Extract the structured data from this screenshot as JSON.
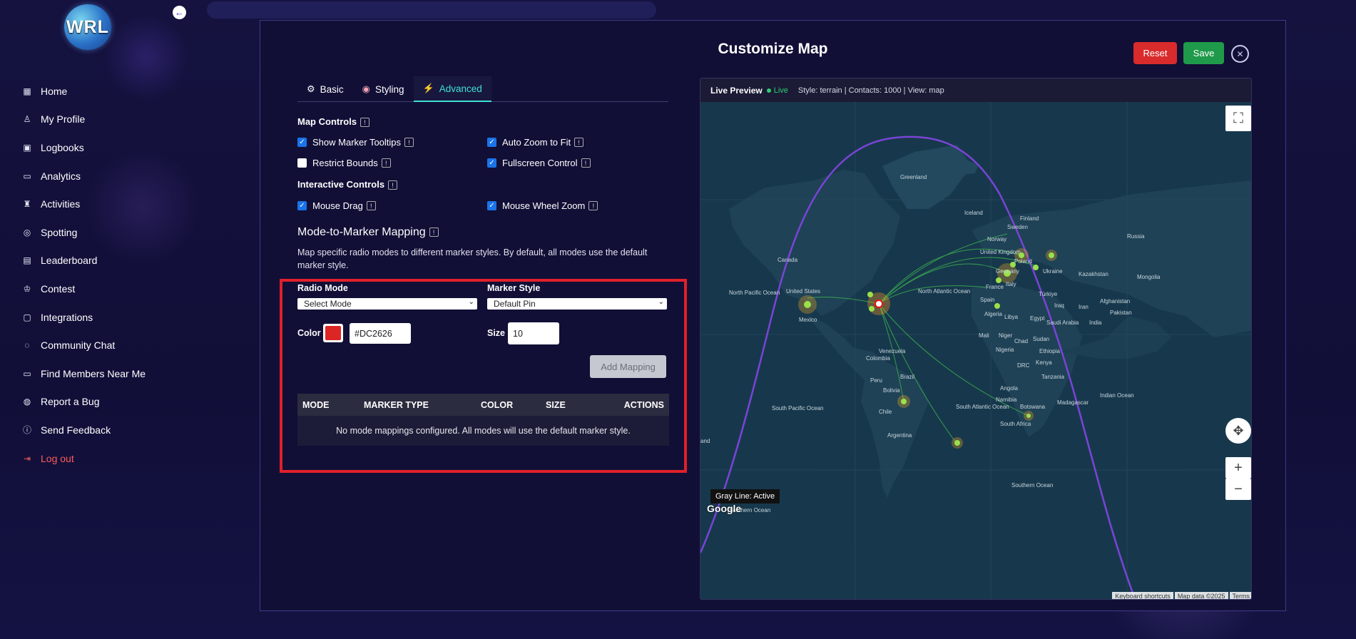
{
  "app": {
    "logo_text": "WRL"
  },
  "sidebar": {
    "items": [
      {
        "label": "Home",
        "icon": "grid-icon"
      },
      {
        "label": "My Profile",
        "icon": "user-icon"
      },
      {
        "label": "Logbooks",
        "icon": "contact-book-icon"
      },
      {
        "label": "Analytics",
        "icon": "chart-icon"
      },
      {
        "label": "Activities",
        "icon": "people-icon"
      },
      {
        "label": "Spotting",
        "icon": "radar-icon"
      },
      {
        "label": "Leaderboard",
        "icon": "podium-icon"
      },
      {
        "label": "Contest",
        "icon": "trophy-icon"
      },
      {
        "label": "Integrations",
        "icon": "plug-icon"
      },
      {
        "label": "Community Chat",
        "icon": "chat-icon"
      },
      {
        "label": "Find Members Near Me",
        "icon": "folder-icon"
      },
      {
        "label": "Report a Bug",
        "icon": "bug-icon"
      },
      {
        "label": "Send Feedback",
        "icon": "alert-circle-icon"
      },
      {
        "label": "Log out",
        "icon": "logout-icon"
      }
    ]
  },
  "modal": {
    "title": "Customize Map",
    "reset_label": "Reset",
    "save_label": "Save",
    "tabs": [
      {
        "label": "Basic",
        "icon": "gear-icon"
      },
      {
        "label": "Styling",
        "icon": "palette-icon"
      },
      {
        "label": "Advanced",
        "icon": "lightning-icon"
      }
    ],
    "active_tab": "Advanced",
    "map_controls": {
      "heading": "Map Controls",
      "items": [
        {
          "label": "Show Marker Tooltips",
          "checked": true
        },
        {
          "label": "Auto Zoom to Fit",
          "checked": true
        },
        {
          "label": "Restrict Bounds",
          "checked": false
        },
        {
          "label": "Fullscreen Control",
          "checked": true
        }
      ]
    },
    "interactive_controls": {
      "heading": "Interactive Controls",
      "items": [
        {
          "label": "Mouse Drag",
          "checked": true
        },
        {
          "label": "Mouse Wheel Zoom",
          "checked": true
        }
      ]
    },
    "mapping": {
      "heading": "Mode-to-Marker Mapping",
      "description": "Map specific radio modes to different marker styles. By default, all modes use the default marker style.",
      "radio_mode_label": "Radio Mode",
      "radio_mode_value": "Select Mode",
      "marker_style_label": "Marker Style",
      "marker_style_value": "Default Pin",
      "color_label": "Color",
      "color_value": "#DC2626",
      "size_label": "Size",
      "size_value": "10",
      "add_button": "Add Mapping",
      "columns": [
        "MODE",
        "MARKER TYPE",
        "COLOR",
        "SIZE",
        "ACTIONS"
      ],
      "empty_text": "No mode mappings configured. All modes will use the default marker style."
    }
  },
  "preview": {
    "title": "Live Preview",
    "status": "Live",
    "info": "Style: terrain | Contacts: 1000 | View: map",
    "gray_line": "Gray Line: Active",
    "google": "Google",
    "attribution": [
      "Keyboard shortcuts",
      "Map data ©2025",
      "Terms"
    ],
    "labels": [
      {
        "text": "Greenland"
      },
      {
        "text": "Iceland"
      },
      {
        "text": "Finland"
      },
      {
        "text": "Sweden"
      },
      {
        "text": "Norway"
      },
      {
        "text": "Russia"
      },
      {
        "text": "United Kingdom"
      },
      {
        "text": "Poland"
      },
      {
        "text": "Ukraine"
      },
      {
        "text": "Kazakhstan"
      },
      {
        "text": "Mongolia"
      },
      {
        "text": "Germany"
      },
      {
        "text": "France"
      },
      {
        "text": "Spain"
      },
      {
        "text": "Italy"
      },
      {
        "text": "Türkiye"
      },
      {
        "text": "Iraq"
      },
      {
        "text": "Iran"
      },
      {
        "text": "Afghanistan"
      },
      {
        "text": "Pakistan"
      },
      {
        "text": "Canada"
      },
      {
        "text": "United States"
      },
      {
        "text": "Mexico"
      },
      {
        "text": "North Pacific Ocean"
      },
      {
        "text": "North Atlantic Ocean"
      },
      {
        "text": "Algeria"
      },
      {
        "text": "Libya"
      },
      {
        "text": "Egypt"
      },
      {
        "text": "Saudi Arabia"
      },
      {
        "text": "India"
      },
      {
        "text": "Mali"
      },
      {
        "text": "Niger"
      },
      {
        "text": "Chad"
      },
      {
        "text": "Sudan"
      },
      {
        "text": "Nigeria"
      },
      {
        "text": "Ethiopia"
      },
      {
        "text": "Venezuela"
      },
      {
        "text": "Colombia"
      },
      {
        "text": "DRC"
      },
      {
        "text": "Kenya"
      },
      {
        "text": "Tanzania"
      },
      {
        "text": "Brazil"
      },
      {
        "text": "Peru"
      },
      {
        "text": "Bolivia"
      },
      {
        "text": "Angola"
      },
      {
        "text": "Namibia"
      },
      {
        "text": "Botswana"
      },
      {
        "text": "Madagascar"
      },
      {
        "text": "Indian Ocean"
      },
      {
        "text": "Chile"
      },
      {
        "text": "Argentina"
      },
      {
        "text": "South Pacific Ocean"
      },
      {
        "text": "South Atlantic Ocean"
      },
      {
        "text": "South Africa"
      },
      {
        "text": "Southern Ocean"
      },
      {
        "text": "Southern Ocean"
      },
      {
        "text": "and"
      }
    ]
  }
}
